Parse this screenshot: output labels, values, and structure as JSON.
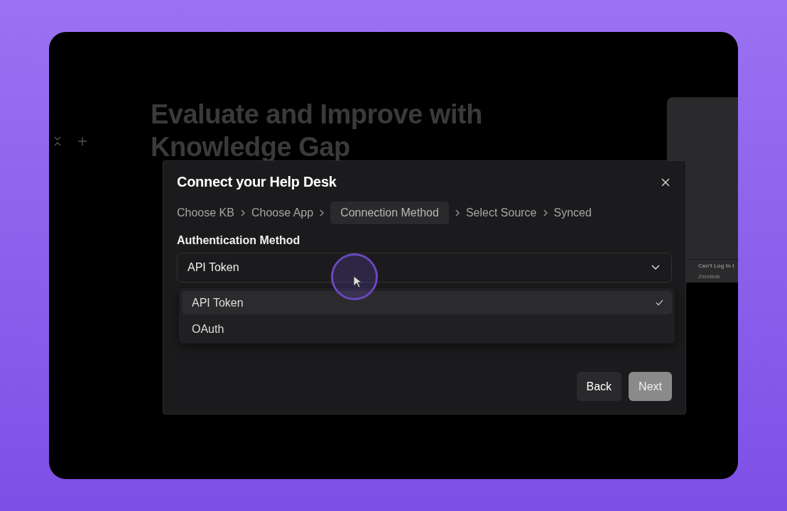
{
  "background": {
    "headline": "Evaluate and Improve with Knowledge Gap",
    "preview_card": {
      "title": "Can't Log In t",
      "source": "Zendesk"
    }
  },
  "dialog": {
    "title": "Connect your Help Desk",
    "steps": [
      {
        "label": "Choose KB",
        "selected": false
      },
      {
        "label": "Choose App",
        "selected": false
      },
      {
        "label": "Connection Method",
        "selected": true
      },
      {
        "label": "Select Source",
        "selected": false
      },
      {
        "label": "Synced",
        "selected": false
      }
    ],
    "field": {
      "label": "Authentication Method",
      "value": "API Token",
      "expanded": true
    },
    "options": [
      {
        "label": "API Token",
        "selected": true
      },
      {
        "label": "OAuth",
        "selected": false
      }
    ],
    "buttons": [
      {
        "label": "Back",
        "kind": "secondary"
      },
      {
        "label": "Next",
        "kind": "primary"
      }
    ]
  }
}
